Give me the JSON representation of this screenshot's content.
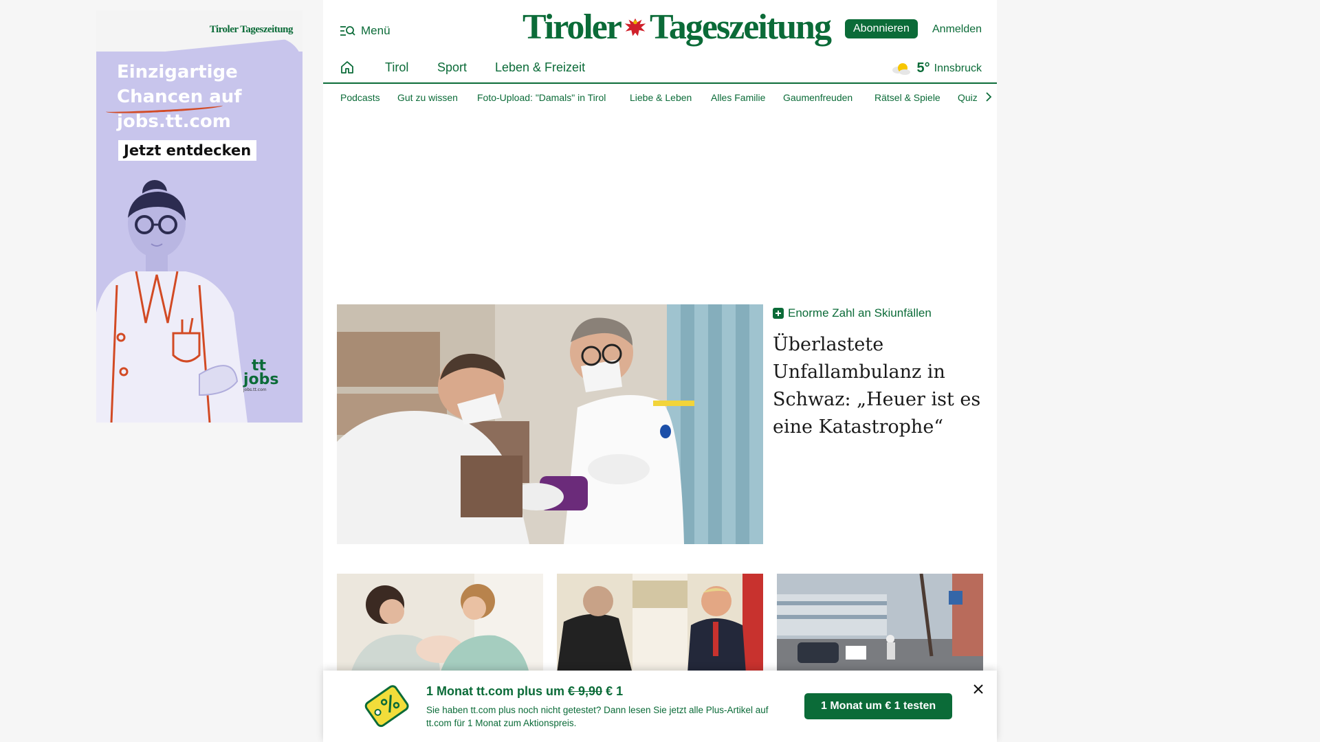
{
  "ad": {
    "logo": "Tiroler Tageszeitung",
    "headline_line1": "Einzigartige",
    "headline_line2": "Chancen auf",
    "headline_line3": "jobs.tt.com",
    "cta": "Jetzt entdecken",
    "brand_tt": "tt",
    "brand_jobs": "jobs",
    "brand_url": "jobs.tt.com"
  },
  "header": {
    "menu_label": "Menü",
    "brand_left": "Tiroler",
    "brand_right": "Tageszeitung",
    "subscribe_label": "Abonnieren",
    "login_label": "Anmelden"
  },
  "nav": {
    "items": [
      "Tirol",
      "Sport",
      "Leben & Freizeit"
    ],
    "weather_temp": "5°",
    "weather_city": "Innsbruck"
  },
  "subnav": {
    "items": [
      "Podcasts",
      "Gut zu wissen",
      "Foto-Upload: \"Damals\" in Tirol",
      "Liebe & Leben",
      "Alles Familie",
      "Gaumenfreuden",
      "Rätsel & Spiele",
      "Quiz"
    ]
  },
  "hero": {
    "kicker": "Enorme Zahl an Skiunfällen",
    "title": "Überlastete Unfallambulanz in Schwaz: „Heuer ist es eine Katastrophe“"
  },
  "promo": {
    "title_prefix": "1 Monat tt.com plus um",
    "old_price": "€ 9,90",
    "new_price": "€ 1",
    "text": "Sie haben tt.com plus noch nicht getestet? Dann lesen Sie jetzt alle Plus-Artikel auf tt.com für 1 Monat zum Aktionspreis.",
    "button_label": "1 Monat um € 1 testen"
  },
  "colors": {
    "brand_green": "#0b6b38",
    "ad_lavender": "#c8c5ec",
    "ad_accent": "#d24a24"
  }
}
